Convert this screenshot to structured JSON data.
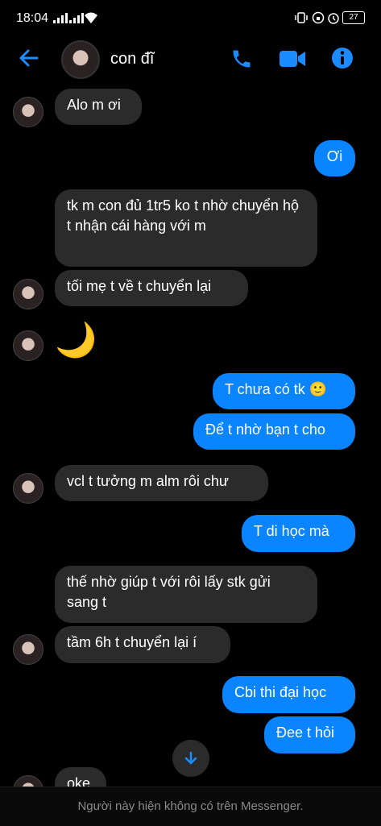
{
  "status": {
    "time": "18:04",
    "battery": "27"
  },
  "header": {
    "contact_name": "con đĩ"
  },
  "messages": {
    "m1": "Alo m ơi",
    "m2": "Ơi",
    "m3": "tk m con đủ 1tr5 ko t nhờ chuyển hộ t nhận cái hàng với m",
    "m4": "tối mẹ t về t chuyển lại",
    "m5": "🌙",
    "m6": "T chưa có tk 🙂",
    "m7": "Để t nhờ bạn t cho",
    "m8": "vcl t tưởng m alm rôi chư",
    "m9": "T di học mà",
    "m10": "thế nhờ giúp t với rôi lấy stk gửi sang t",
    "m11": "tầm 6h t chuyển lại í",
    "m12": "Cbi thi đại học",
    "m13": "Đee t hỏi",
    "m14": "oke"
  },
  "footer": {
    "notice": "Người này hiện không có trên Messenger."
  },
  "colors": {
    "accent": "#0a84ff",
    "incoming_bubble": "#2b2b2b",
    "background": "#000000"
  }
}
